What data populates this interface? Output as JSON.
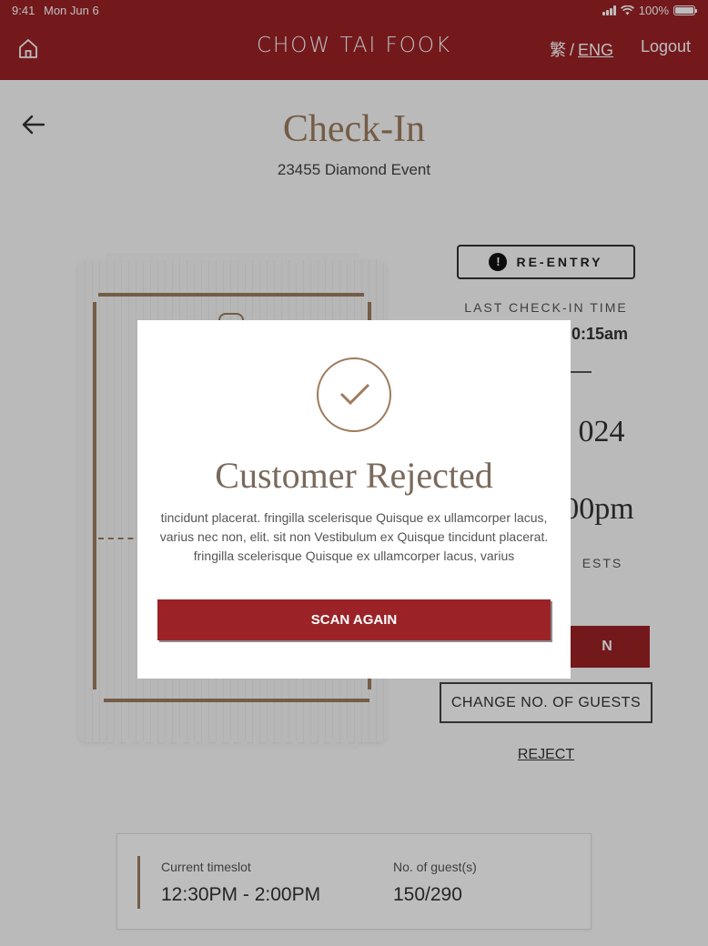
{
  "status_bar": {
    "time": "9:41",
    "date": "Mon Jun 6",
    "battery": "100%"
  },
  "header": {
    "brand": "CHOW TAI FOOK",
    "lang_tc": "繁",
    "lang_sep": "/",
    "lang_eng": "ENG",
    "logout": "Logout"
  },
  "page": {
    "title": "Check-In",
    "subtitle": "23455 Diamond Event"
  },
  "ticket_panel": {
    "reentry_label": "RE-ENTRY",
    "last_checkin_label": "LAST CHECK-IN TIME",
    "last_checkin_value_partial": "0:15am",
    "date_partial": "024",
    "time_partial": "00pm",
    "guests_label_partial": "ESTS",
    "checkin_button_partial": "N",
    "change_guests_button": "CHANGE NO. OF GUESTS",
    "reject_link": "REJECT"
  },
  "info_card": {
    "timeslot_label": "Current timeslot",
    "timeslot_value": "12:30PM - 2:00PM",
    "guests_label": "No. of guest(s)",
    "guests_value": "150/290"
  },
  "modal": {
    "title": "Customer Rejected",
    "message": "tincidunt placerat. fringilla scelerisque Quisque ex ullamcorper lacus, varius nec non, elit. sit non Vestibulum ex Quisque tincidunt placerat. fringilla scelerisque Quisque ex ullamcorper lacus, varius",
    "scan_again": "SCAN AGAIN"
  },
  "colors": {
    "brand_red": "#9b2327",
    "gold": "#9d7c5d"
  }
}
